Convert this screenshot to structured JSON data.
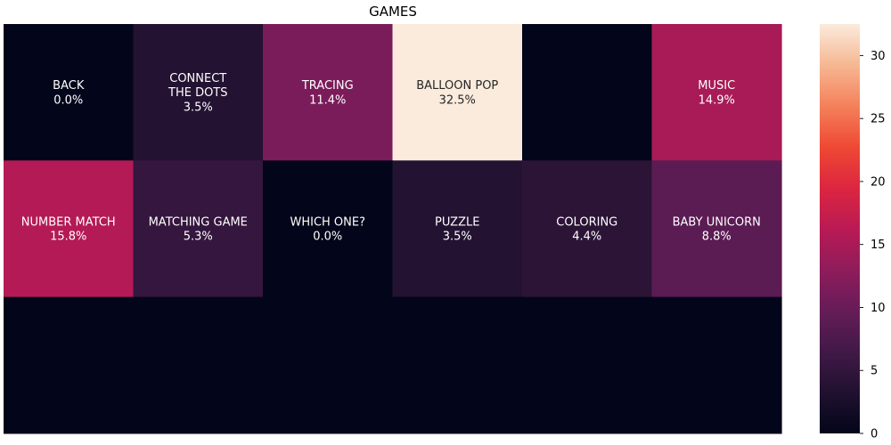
{
  "chart_data": {
    "type": "heatmap",
    "title": "GAMES",
    "rows": 3,
    "cols": 6,
    "cells": [
      [
        {
          "label": [
            "BACK"
          ],
          "value_text": "0.0%",
          "value": 0.0
        },
        {
          "label": [
            "CONNECT",
            "THE DOTS"
          ],
          "value_text": "3.5%",
          "value": 3.5
        },
        {
          "label": [
            "TRACING"
          ],
          "value_text": "11.4%",
          "value": 11.4
        },
        {
          "label": [
            "BALLOON POP"
          ],
          "value_text": "32.5%",
          "value": 32.5
        },
        {
          "label": [],
          "value_text": "",
          "value": 0.0
        },
        {
          "label": [
            "MUSIC"
          ],
          "value_text": "14.9%",
          "value": 14.9
        }
      ],
      [
        {
          "label": [
            "NUMBER MATCH"
          ],
          "value_text": "15.8%",
          "value": 15.8
        },
        {
          "label": [
            "MATCHING GAME"
          ],
          "value_text": "5.3%",
          "value": 5.3
        },
        {
          "label": [
            "WHICH ONE?"
          ],
          "value_text": "0.0%",
          "value": 0.0
        },
        {
          "label": [
            "PUZZLE"
          ],
          "value_text": "3.5%",
          "value": 3.5
        },
        {
          "label": [
            "COLORING"
          ],
          "value_text": "4.4%",
          "value": 4.4
        },
        {
          "label": [
            "BABY UNICORN"
          ],
          "value_text": "8.8%",
          "value": 8.8
        }
      ],
      [
        {
          "label": [],
          "value_text": "",
          "value": 0.0
        },
        {
          "label": [],
          "value_text": "",
          "value": 0.0
        },
        {
          "label": [],
          "value_text": "",
          "value": 0.0
        },
        {
          "label": [],
          "value_text": "",
          "value": 0.0
        },
        {
          "label": [],
          "value_text": "",
          "value": 0.0
        },
        {
          "label": [],
          "value_text": "",
          "value": 0.0
        }
      ]
    ],
    "colorbar": {
      "vmin": 0,
      "vmax": 32.5,
      "ticks": [
        0,
        5,
        10,
        15,
        20,
        25,
        30
      ],
      "colormap": "rocket"
    },
    "grid": false,
    "legend": "right"
  }
}
